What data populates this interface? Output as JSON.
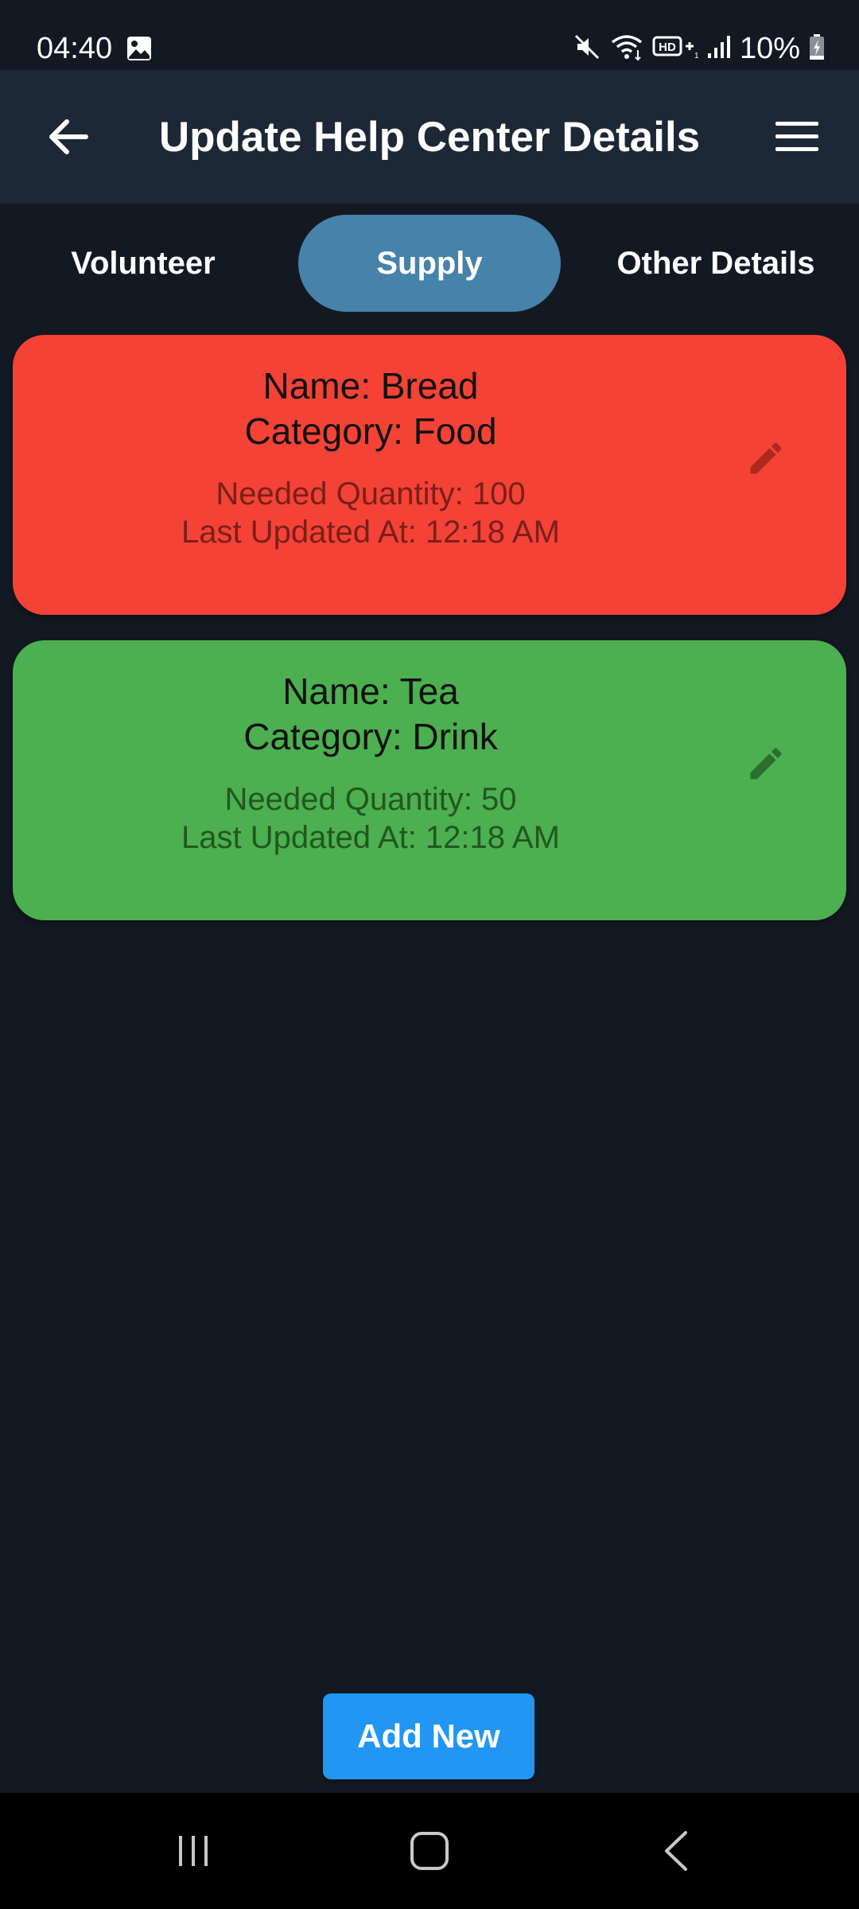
{
  "status_bar": {
    "time": "04:40",
    "battery": "10%",
    "icons": [
      "gallery-icon",
      "mute-icon",
      "wifi-icon",
      "hd-voice-icon",
      "signal-icon",
      "battery-charging-icon"
    ]
  },
  "app_bar": {
    "title": "Update Help Center Details",
    "back_icon": "arrow-back-icon",
    "menu_icon": "hamburger-menu-icon"
  },
  "tabs": [
    {
      "label": "Volunteer",
      "active": false
    },
    {
      "label": "Supply",
      "active": true
    },
    {
      "label": "Other Details",
      "active": false
    }
  ],
  "supplies": [
    {
      "name": "Name: Bread",
      "category": "Category: Food",
      "quantity": "Needed Quantity: 100",
      "updated": "Last Updated At: 12:18 AM",
      "color": "#f44236",
      "text_muted": "#7a1f1a",
      "icon_color": "#b0271e",
      "icon": "edit-pencil-icon"
    },
    {
      "name": "Name: Tea",
      "category": "Category: Drink",
      "quantity": "Needed Quantity: 50",
      "updated": "Last Updated At: 12:18 AM",
      "color": "#4caf50",
      "text_muted": "#22571f",
      "icon_color": "#2d6e2a",
      "icon": "edit-pencil-icon"
    }
  ],
  "add_button": {
    "label": "Add New",
    "color": "#2196f3"
  },
  "colors": {
    "background": "#131923",
    "app_bar": "#1d2836",
    "active_tab": "#4682a9"
  },
  "nav_bar": {
    "items": [
      "recent-apps-icon",
      "home-icon",
      "back-nav-icon"
    ]
  }
}
